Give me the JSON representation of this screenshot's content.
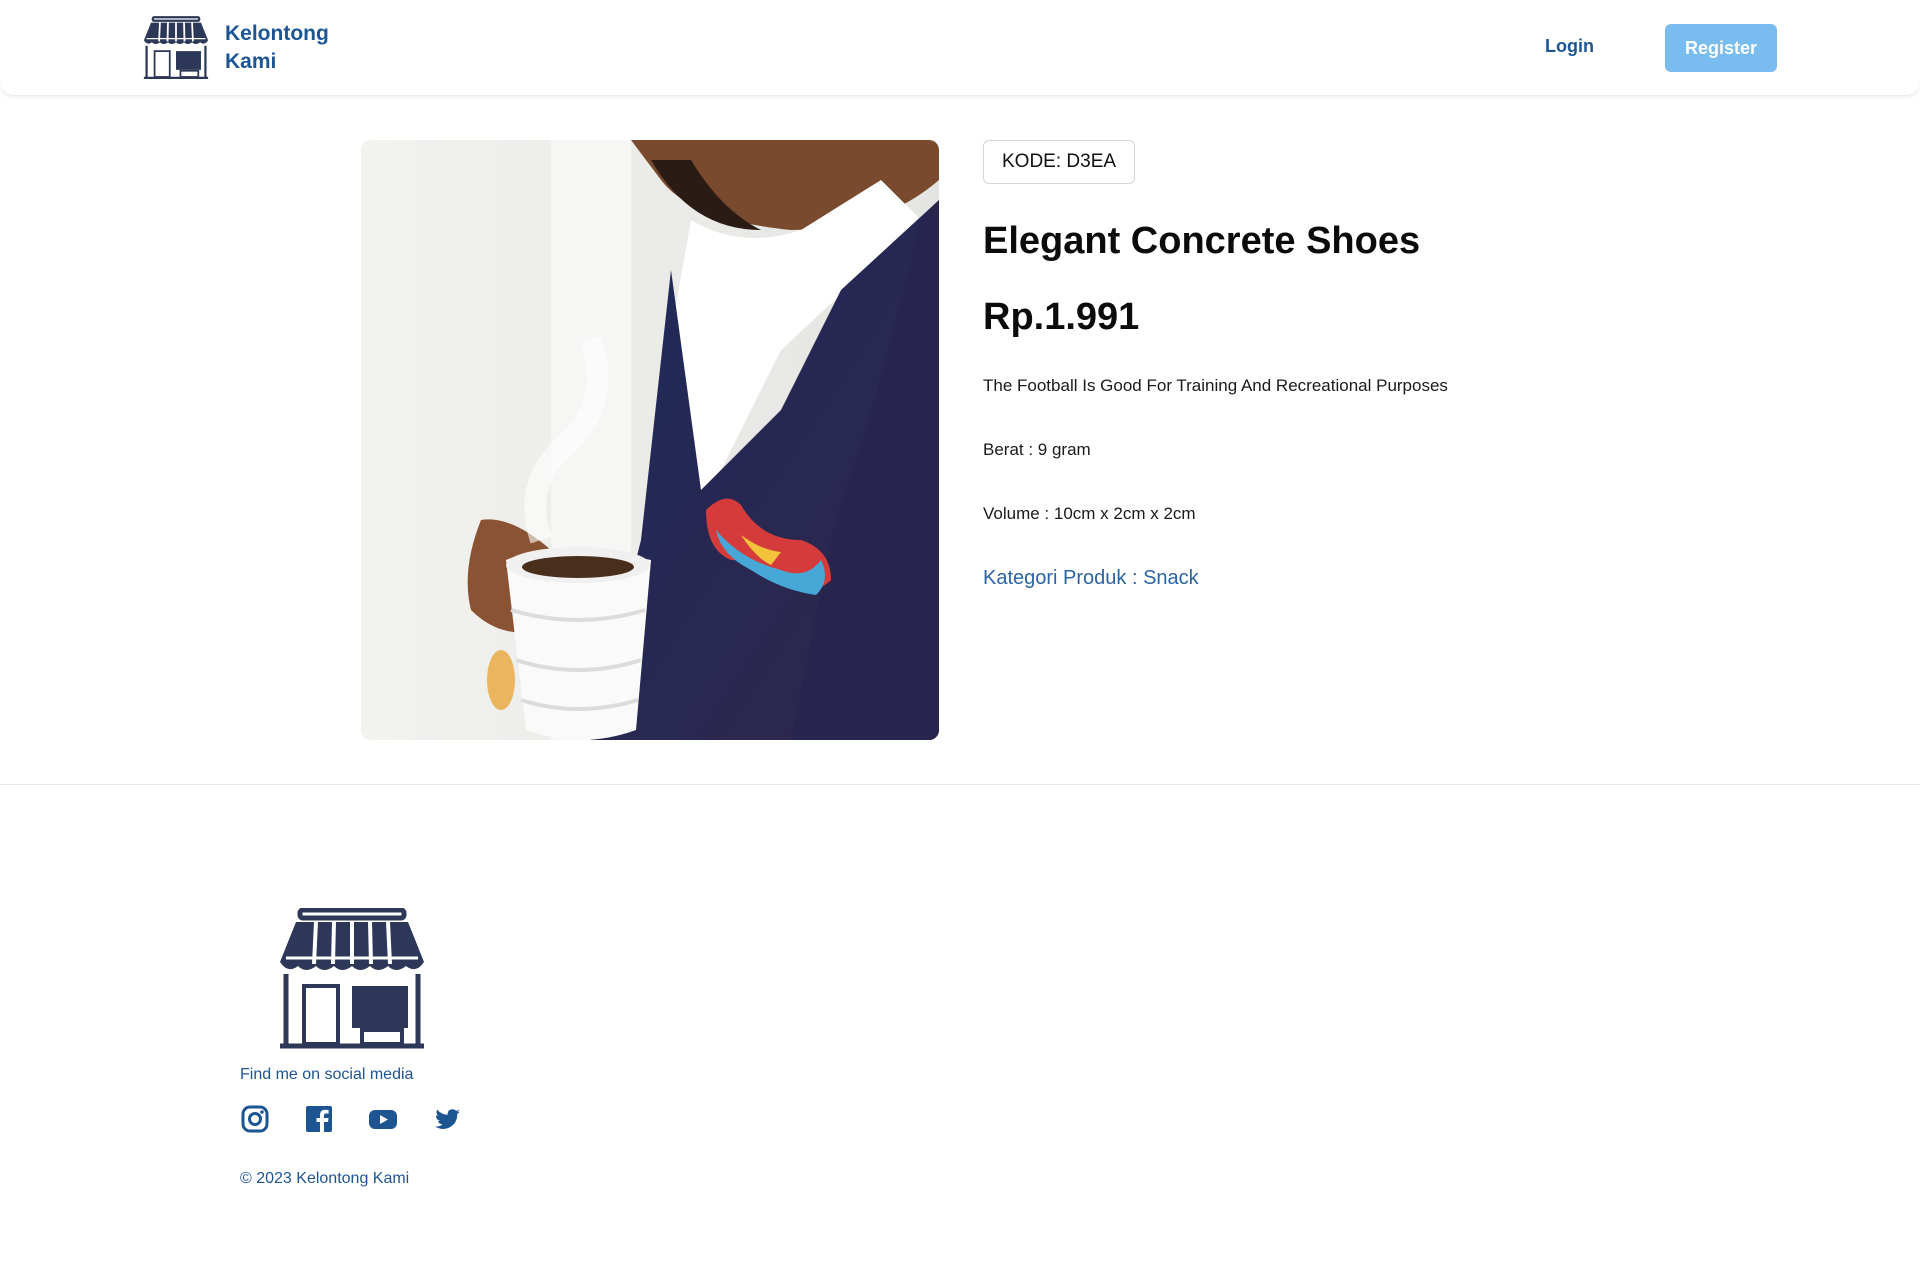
{
  "header": {
    "brand_name": "Kelontong Kami",
    "login_label": "Login",
    "register_label": "Register"
  },
  "product": {
    "code": "KODE: D3EA",
    "title": "Elegant Concrete Shoes",
    "price": "Rp.1.991",
    "description": "The Football Is Good For Training And Recreational Purposes",
    "weight": "Berat : 9 gram",
    "volume": "Volume : 10cm x 2cm x 2cm",
    "category": "Kategori Produk : Snack"
  },
  "footer": {
    "social_text": "Find me on social media",
    "social_icons": [
      "instagram-icon",
      "facebook-icon",
      "youtube-icon",
      "twitter-icon"
    ],
    "copyright": "© 2023 Kelontong Kami"
  },
  "colors": {
    "brand_blue": "#1d5593",
    "register_button": "#79bcef",
    "link_blue": "#2b64a6",
    "logo_navy": "#2d3757"
  }
}
